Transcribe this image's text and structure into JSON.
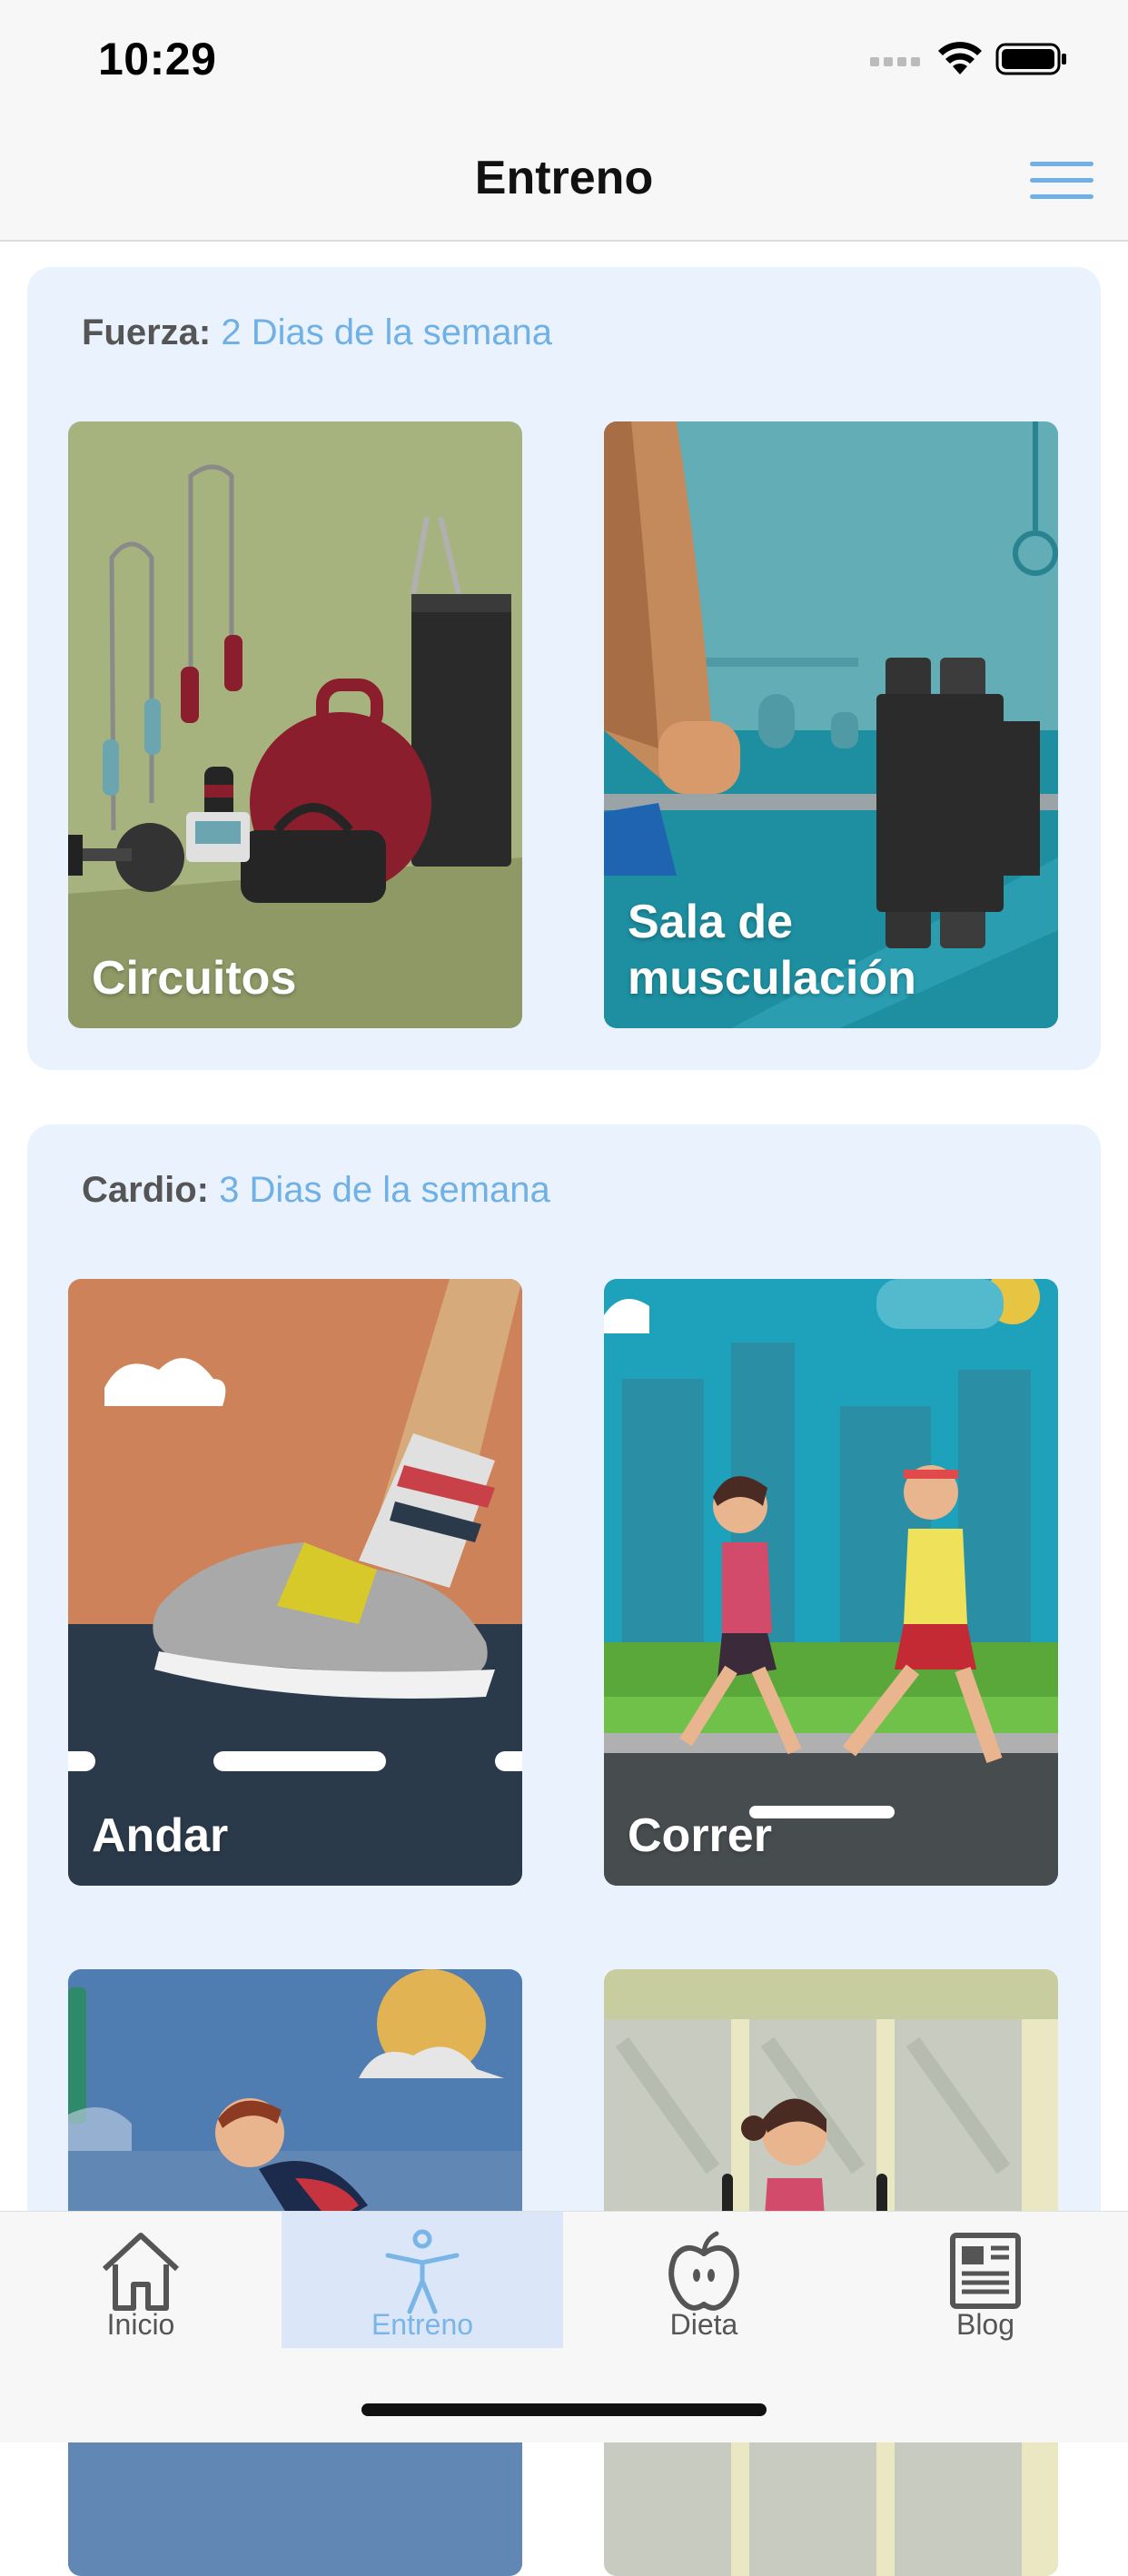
{
  "status": {
    "time": "10:29"
  },
  "nav": {
    "title": "Entreno"
  },
  "sections": [
    {
      "label": "Fuerza:",
      "value": "2 Dias de la semana",
      "cards": [
        {
          "label": "Circuitos"
        },
        {
          "label": "Sala de musculación"
        }
      ]
    },
    {
      "label": "Cardio:",
      "value": "3 Dias de la semana",
      "cards": [
        {
          "label": "Andar"
        },
        {
          "label": "Correr"
        }
      ]
    }
  ],
  "tabs": [
    {
      "label": "Inicio",
      "icon": "home-icon"
    },
    {
      "label": "Entreno",
      "icon": "person-icon",
      "active": true
    },
    {
      "label": "Dieta",
      "icon": "apple-icon"
    },
    {
      "label": "Blog",
      "icon": "newspaper-icon"
    }
  ],
  "colors": {
    "accent": "#6fb0e6",
    "section_bg": "#eaf3fd",
    "active_tab_bg": "#dbe6f8"
  }
}
